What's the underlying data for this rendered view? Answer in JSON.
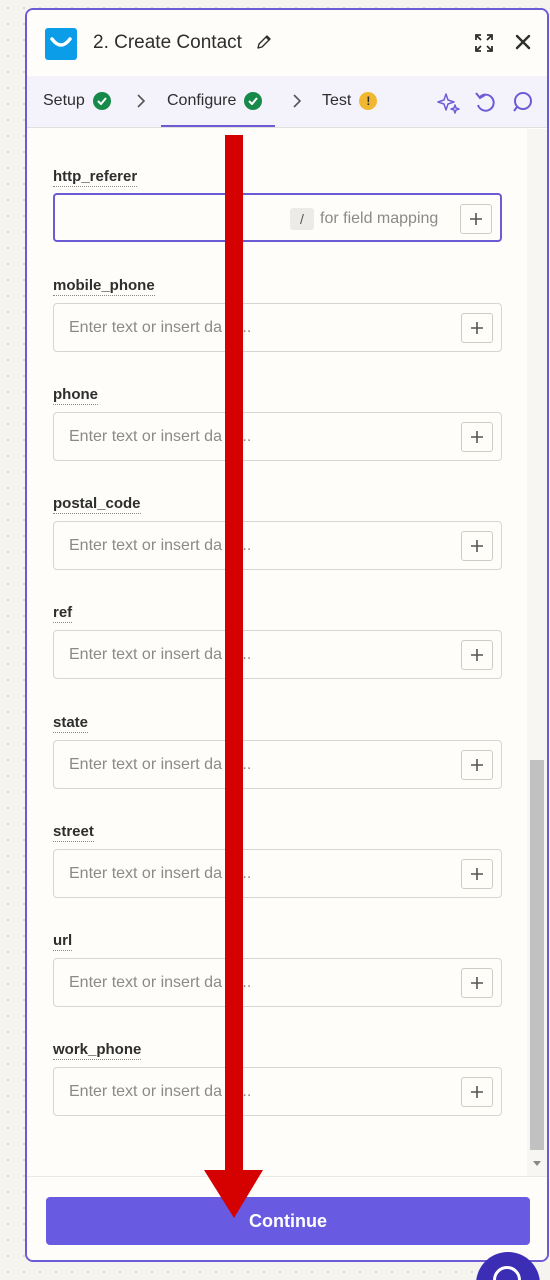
{
  "header": {
    "title": "2. Create Contact",
    "icons": {
      "app_logo": "getresponse-logo",
      "edit": "pencil-icon",
      "expand": "expand-icon",
      "close": "close-icon"
    }
  },
  "tabs": [
    {
      "label": "Setup",
      "status": "complete"
    },
    {
      "label": "Configure",
      "status": "complete",
      "active": true
    },
    {
      "label": "Test",
      "status": "warning",
      "badge": "!"
    }
  ],
  "toolbar": {
    "icons": [
      "sparkle-icon",
      "undo-icon",
      "comment-icon"
    ]
  },
  "fields": [
    {
      "label": "http_referer",
      "value": "",
      "hint_key": "/",
      "hint_text": "for field mapping",
      "active": true
    },
    {
      "label": "mobile_phone",
      "placeholder": "Enter text or insert da"
    },
    {
      "label": "phone",
      "placeholder": "Enter text or insert da"
    },
    {
      "label": "postal_code",
      "placeholder": "Enter text or insert da"
    },
    {
      "label": "ref",
      "placeholder": "Enter text or insert da"
    },
    {
      "label": "state",
      "placeholder": "Enter text or insert da"
    },
    {
      "label": "street",
      "placeholder": "Enter text or insert da"
    },
    {
      "label": "url",
      "placeholder": "Enter text or insert da"
    },
    {
      "label": "work_phone",
      "placeholder": "Enter text or insert da"
    }
  ],
  "placeholder_tail": "...",
  "footer": {
    "continue_label": "Continue"
  },
  "colors": {
    "accent": "#695be1",
    "success": "#178a4a",
    "warning": "#f2b730",
    "annotation_arrow": "#d50000"
  }
}
